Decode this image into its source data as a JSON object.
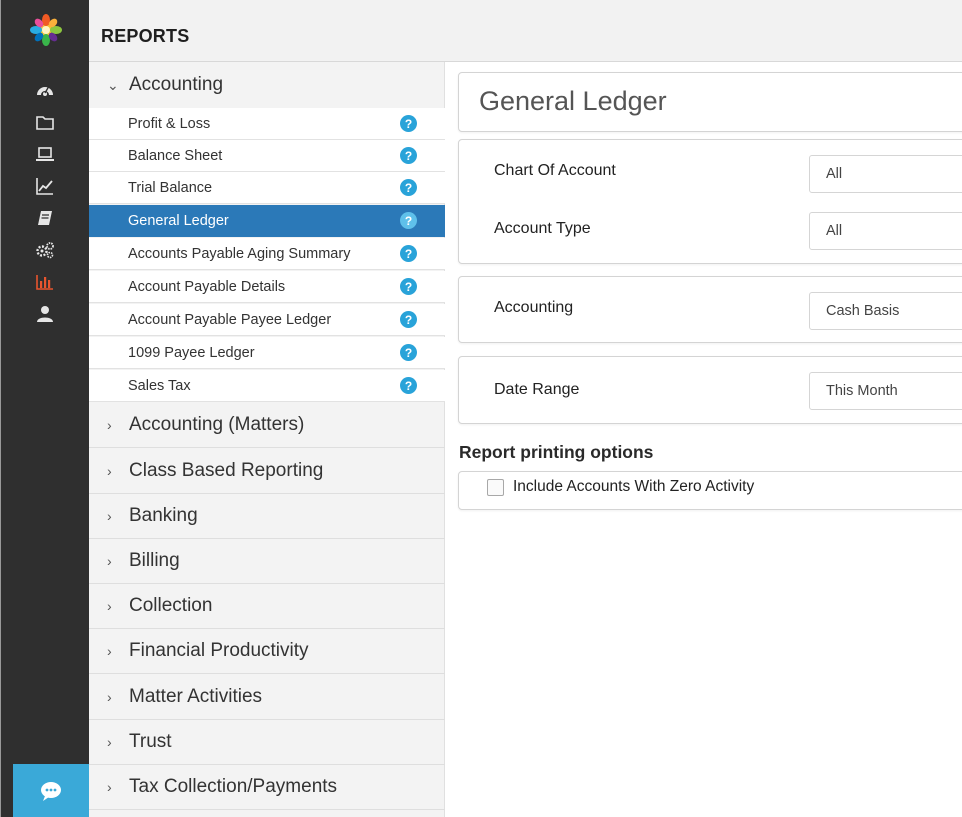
{
  "header": {
    "title": "REPORTS"
  },
  "rail": {
    "items": [
      {
        "icon": "dashboard-icon"
      },
      {
        "icon": "folder-icon"
      },
      {
        "icon": "laptop-icon"
      },
      {
        "icon": "line-chart-icon"
      },
      {
        "icon": "book-icon"
      },
      {
        "icon": "gears-icon"
      },
      {
        "icon": "bar-chart-icon",
        "active": true
      },
      {
        "icon": "user-icon"
      }
    ],
    "chat_icon": "chat-icon",
    "active_color": "#e8552e"
  },
  "menu": {
    "open_group": "Accounting",
    "sub_items": [
      "Profit & Loss",
      "Balance Sheet",
      "Trial Balance",
      "General Ledger",
      "Accounts Payable Aging Summary",
      "Account Payable Details",
      "Account Payable Payee Ledger",
      "1099 Payee Ledger",
      "Sales Tax"
    ],
    "help_glyph": "?",
    "groups": [
      "Accounting (Matters)",
      "Class Based Reporting",
      "Banking",
      "Billing",
      "Collection",
      "Financial Productivity",
      "Matter Activities",
      "Trust",
      "Tax Collection/Payments"
    ]
  },
  "main": {
    "title": "General Ledger",
    "chart_of_account": {
      "label": "Chart Of Account",
      "value": "All"
    },
    "account_type": {
      "label": "Account Type",
      "value": "All"
    },
    "accounting": {
      "label": "Accounting",
      "value": "Cash Basis"
    },
    "date_range": {
      "label": "Date Range",
      "value": "This Month"
    },
    "printing": {
      "title": "Report printing options",
      "zero_activity": {
        "label": "Include Accounts With Zero Activity",
        "checked": false
      }
    }
  },
  "colors": {
    "accent": "#2b79b8",
    "help": "#29a3d9",
    "rail": "#2f2f2f"
  }
}
